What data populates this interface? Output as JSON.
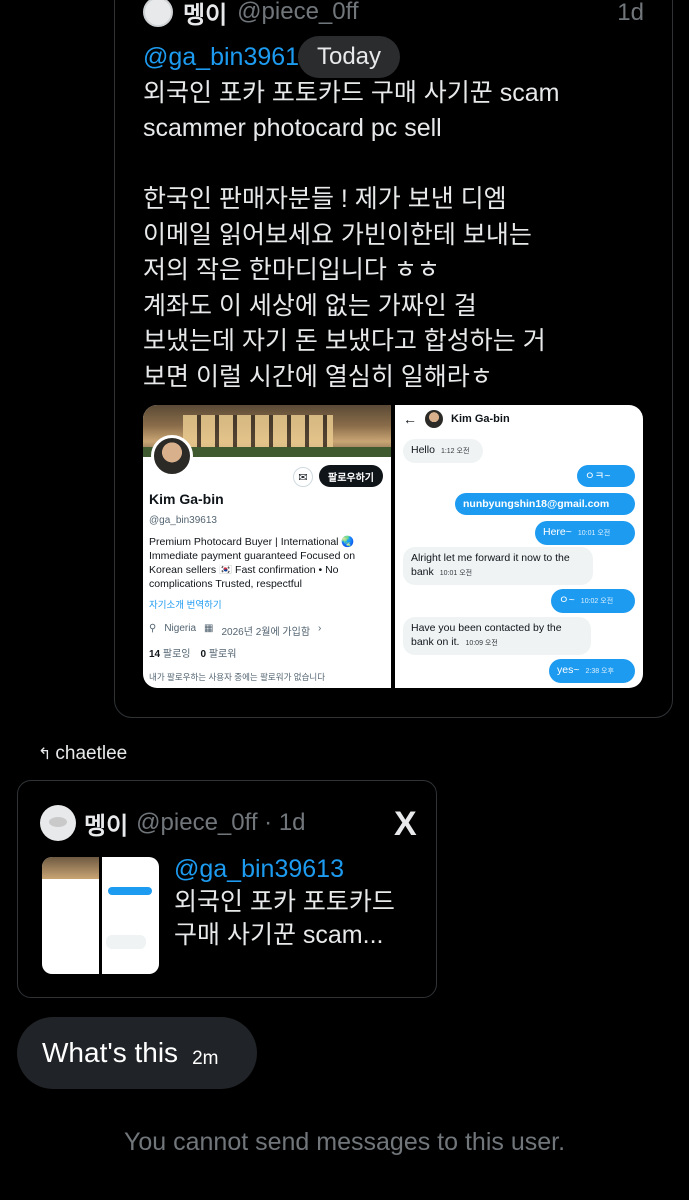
{
  "quoted_tweet": {
    "name": "멩이",
    "handle": "@piece_0ff",
    "time": "1d",
    "mention": "@ga_bin3961",
    "text_after_mention": "\n외국인 포카 포토카드 구매 사기꾼 scam\nscammer photocard pc sell\n\n한국인 판매자분들 ! 제가 보낸 디엠\n이메일 읽어보세요 가빈이한테 보내는\n저의 작은 한마디입니다 ㅎㅎ\n계좌도 이 세상에 없는 가짜인 걸\n보냈는데 자기 돈 보냈다고 합성하는 거\n보면 이럴 시간에 열심히 일해라ㅎ"
  },
  "date_pill": "Today",
  "profile_image": {
    "follow_button": "팔로우하기",
    "mail_icon": "mail-icon",
    "name": "Kim Ga-bin",
    "handle": "@ga_bin39613",
    "bio": "Premium Photocard Buyer | International 🌏 Immediate payment guaranteed Focused on Korean sellers 🇰🇷 Fast confirmation • No complications Trusted, respectful",
    "translate": "자기소개 번역하기",
    "location": "Nigeria",
    "joined": "2026년 2월에 가입함",
    "following_count": "14",
    "following_label": "팔로잉",
    "followers_count": "0",
    "followers_label": "팔로워",
    "note": "내가 팔로우하는 사용자 중에는 팔로워가 없습니다"
  },
  "dm_image": {
    "name": "Kim Ga-bin",
    "messages": [
      {
        "dir": "in",
        "text": "Hello",
        "time": "1:12 오전"
      },
      {
        "dir": "out",
        "text": "ㅇㅋ~",
        "time": ""
      },
      {
        "dir": "out",
        "text": "nunbyungshin18@gmail.com",
        "time": ""
      },
      {
        "dir": "out",
        "text": "Here~",
        "time": "10:01 오전"
      },
      {
        "dir": "in",
        "text": "Alright let me forward it now to the bank",
        "time": "10:01 오전"
      },
      {
        "dir": "out",
        "text": "ㅇ~",
        "time": "10:02 오전"
      },
      {
        "dir": "in",
        "text": "Have you been contacted by the bank on it.",
        "time": "10:09 오전"
      },
      {
        "dir": "out",
        "text": "yes~",
        "time": "2:38 오후"
      }
    ]
  },
  "reply": {
    "label": "chaetlee",
    "icon": "reply-arrow-icon"
  },
  "quote_card": {
    "name": "멩이",
    "handle": "@piece_0ff · 1d",
    "logo": "X",
    "mention": "@ga_bin39613",
    "text": "\n외국인 포카 포토카드\n구매 사기꾼 scam..."
  },
  "message": {
    "text": "What's this",
    "time": "2m"
  },
  "footer": "You cannot send messages to this user.",
  "colors": {
    "background": "#000000",
    "accent": "#1d9bf0",
    "muted": "#71767b",
    "bubble": "#202327"
  }
}
